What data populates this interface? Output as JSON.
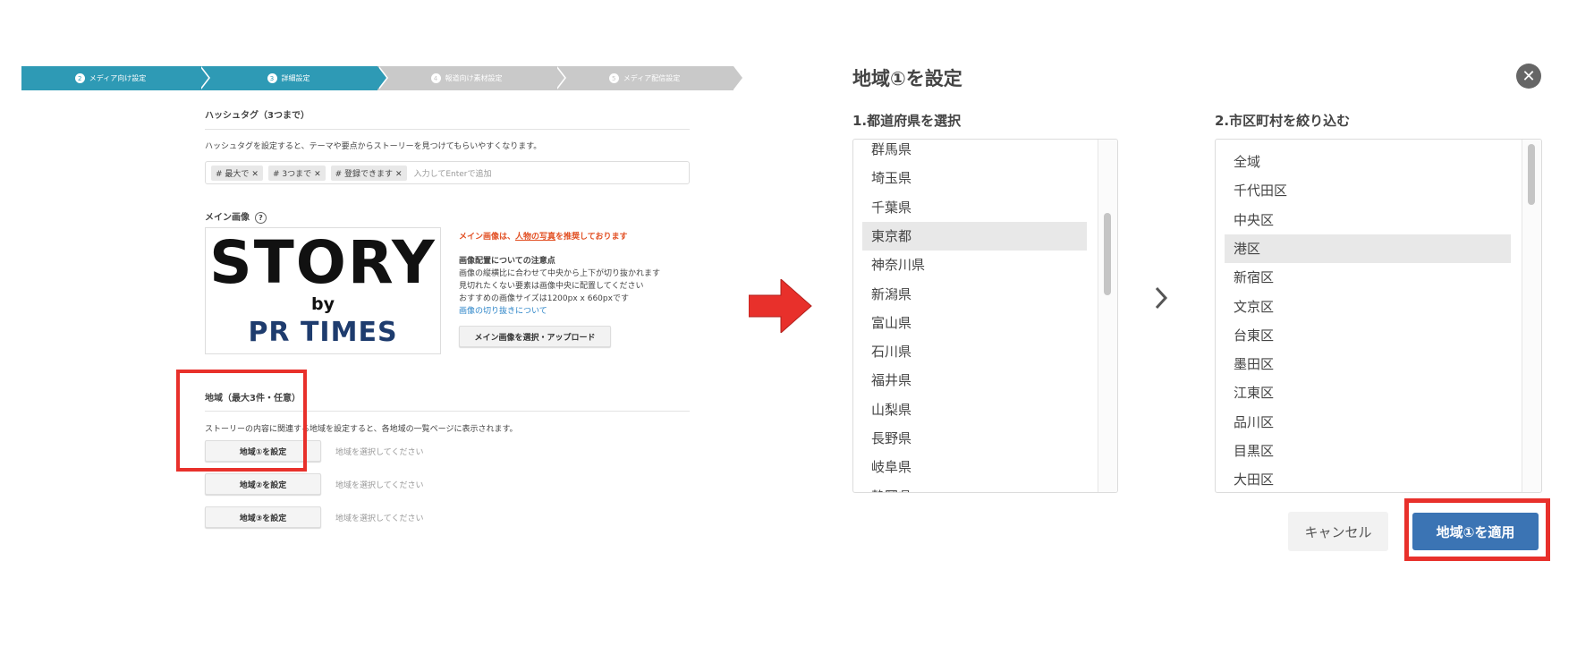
{
  "stepper": {
    "steps": [
      {
        "num": "2",
        "label": "メディア向け設定",
        "active": true
      },
      {
        "num": "3",
        "label": "詳細設定",
        "active": true
      },
      {
        "num": "4",
        "label": "報道向け素材設定",
        "active": false
      },
      {
        "num": "5",
        "label": "メディア配信設定",
        "active": false
      }
    ]
  },
  "hashtag": {
    "title": "ハッシュタグ（3つまで）",
    "description": "ハッシュタグを設定すると、テーマや要点からストーリーを見つけてもらいやすくなります。",
    "tags": [
      "# 最大で",
      "# 3つまで",
      "# 登録できます"
    ],
    "remove_glyph": "✕",
    "placeholder": "入力してEnterで追加"
  },
  "main_image": {
    "title": "メイン画像",
    "help_glyph": "?",
    "logo": {
      "line1": "STORY",
      "line2": "by",
      "line3": "PR TIMES"
    },
    "warning_prefix": "メイン画像は、",
    "warning_link": "人物の写真",
    "warning_suffix": "を推奨しております",
    "notes_title": "画像配置についての注意点",
    "notes": [
      "画像の縦横比に合わせて中央から上下が切り抜かれます",
      "見切れたくない要素は画像中央に配置してください",
      "おすすめの画像サイズは1200px x 660pxです"
    ],
    "notes_link": "画像の切り抜きについて",
    "upload_label": "メイン画像を選択・アップロード"
  },
  "region": {
    "title": "地域（最大3件・任意）",
    "description": "ストーリーの内容に関連する地域を設定すると、各地域の一覧ページに表示されます。",
    "buttons": [
      "地域①を設定",
      "地域②を設定",
      "地域③を設定"
    ],
    "hint": "地域を選択してください"
  },
  "dialog": {
    "title": "地域①を設定",
    "close_glyph": "✕",
    "col1_title": "1.都道府県を選択",
    "prefectures": [
      "群馬県",
      "埼玉県",
      "千葉県",
      "東京都",
      "神奈川県",
      "新潟県",
      "富山県",
      "石川県",
      "福井県",
      "山梨県",
      "長野県",
      "岐阜県",
      "静岡県"
    ],
    "selected_prefecture": "東京都",
    "col2_title": "2.市区町村を絞り込む",
    "wards": [
      "全域",
      "千代田区",
      "中央区",
      "港区",
      "新宿区",
      "文京区",
      "台東区",
      "墨田区",
      "江東区",
      "品川区",
      "目黒区",
      "大田区"
    ],
    "selected_ward": "港区",
    "cancel_label": "キャンセル",
    "apply_label": "地域①を適用"
  },
  "colors": {
    "accent_teal": "#2e9ab5",
    "highlight_red": "#e8302b",
    "apply_blue": "#3b74b4"
  }
}
